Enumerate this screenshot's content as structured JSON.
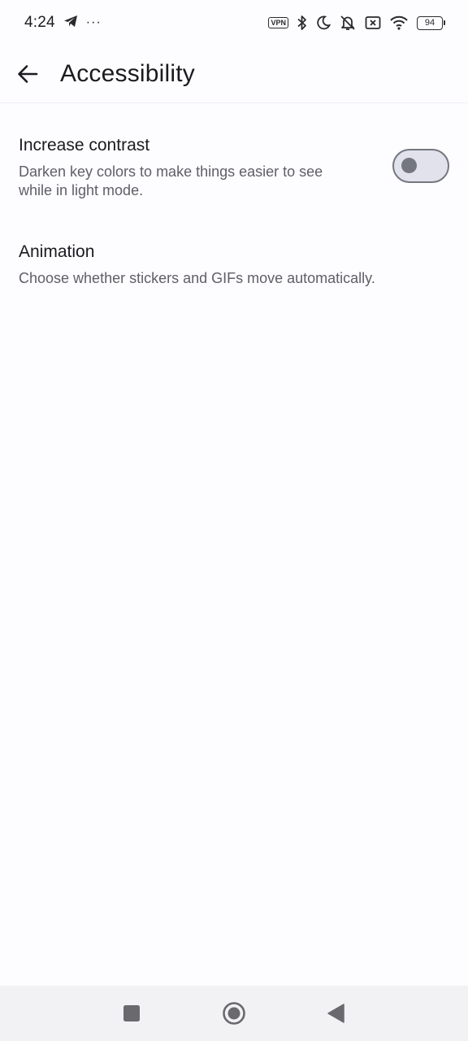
{
  "status_bar": {
    "time": "4:24",
    "more_indicator": "···",
    "vpn_label": "VPN",
    "battery_level": "94",
    "icons": [
      "telegram-icon",
      "bluetooth-icon",
      "moon-icon",
      "muted-bell-icon",
      "no-sim-icon",
      "wifi-icon",
      "battery-icon"
    ]
  },
  "app_bar": {
    "title": "Accessibility",
    "back_icon": "arrow-left-icon"
  },
  "settings": [
    {
      "title": "Increase contrast",
      "description": "Darken key colors to make things easier to see while in light mode.",
      "toggle_on": false
    },
    {
      "title": "Animation",
      "description": "Choose whether stickers and GIFs move automatically."
    }
  ],
  "nav_bar": {
    "icons": [
      "square-recents-icon",
      "circle-home-icon",
      "triangle-back-icon"
    ]
  },
  "colors": {
    "background": "#fdfcff",
    "text_primary": "#1b1b1f",
    "text_secondary": "#5f6066",
    "toggle_outline": "#74777f",
    "toggle_track": "#e1e2ec",
    "nav_bar": "#f2f2f4"
  }
}
